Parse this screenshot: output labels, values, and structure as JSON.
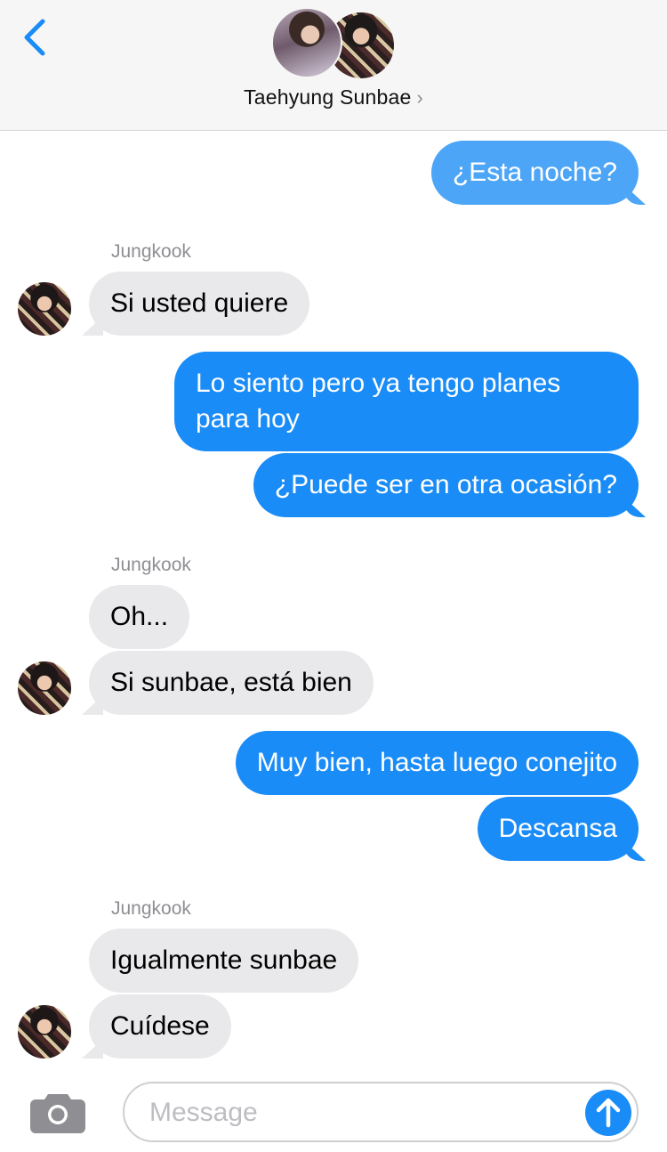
{
  "header": {
    "contact_name": "Taehyung Sunbae",
    "chevron": "›"
  },
  "sender_labels": [
    "Jungkook",
    "Jungkook",
    "Jungkook"
  ],
  "messages": [
    {
      "text": "¿Esta noche?",
      "direction": "outgoing"
    },
    {
      "text": "Si usted quiere",
      "direction": "incoming"
    },
    {
      "text": "Lo siento pero ya tengo planes para hoy",
      "direction": "outgoing"
    },
    {
      "text": "¿Puede ser en otra ocasión?",
      "direction": "outgoing"
    },
    {
      "text": "Oh...",
      "direction": "incoming"
    },
    {
      "text": "Si sunbae, está bien",
      "direction": "incoming"
    },
    {
      "text": "Muy bien, hasta luego conejito",
      "direction": "outgoing"
    },
    {
      "text": "Descansa",
      "direction": "outgoing"
    },
    {
      "text": "Igualmente sunbae",
      "direction": "incoming"
    },
    {
      "text": "Cuídese",
      "direction": "incoming"
    }
  ],
  "composer": {
    "placeholder": "Message",
    "value": "",
    "camera_icon": "camera-icon",
    "send_icon": "arrow-up-icon"
  },
  "colors": {
    "outgoing_bubble": "#1a8cf7",
    "incoming_bubble": "#e9e9eb",
    "accent": "#1a8cf7"
  }
}
